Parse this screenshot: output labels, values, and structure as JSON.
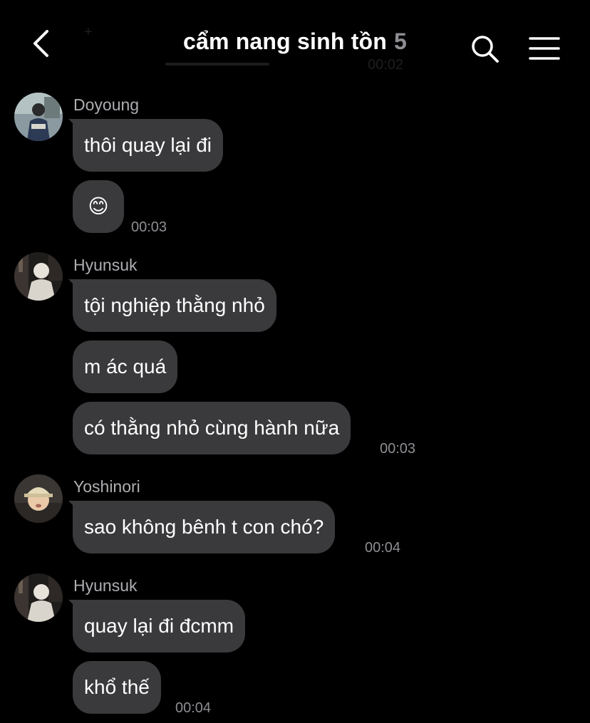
{
  "header": {
    "title": "cẩm nang sinh tồn",
    "member_count": "5",
    "ghost_time": "00:02",
    "ghost_plus": "+"
  },
  "messages": [
    {
      "sender": "Doyoung",
      "texts": [
        "thôi quay lại đi",
        "😊"
      ],
      "time": "00:03"
    },
    {
      "sender": "Hyunsuk",
      "texts": [
        "tội nghiệp thằng nhỏ",
        "m ác quá",
        "có thằng nhỏ cùng hành nữa"
      ],
      "time": "00:03"
    },
    {
      "sender": "Yoshinori",
      "texts": [
        "sao không bênh t con chó?"
      ],
      "time": "00:04"
    },
    {
      "sender": "Hyunsuk",
      "texts": [
        "quay lại đi đcmm",
        "khổ thế"
      ],
      "time": "00:04"
    }
  ],
  "colors": {
    "background": "#000000",
    "bubble": "#3a3a3c",
    "text": "#ffffff",
    "secondary": "#8e8e93"
  },
  "icons": {
    "back": "chevron-left-icon",
    "search": "search-icon",
    "menu": "hamburger-menu-icon"
  }
}
